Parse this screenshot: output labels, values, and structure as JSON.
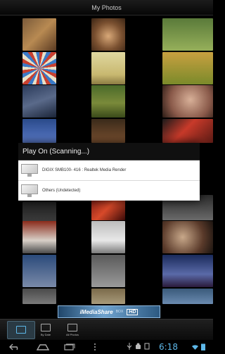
{
  "app": {
    "title": "My Photos"
  },
  "dialog": {
    "title": "Play On (Scanning...)",
    "devices": [
      {
        "label": "DIGIX SMB100- 416 : Realtek Media Render"
      },
      {
        "label": "Others (Undetected)"
      }
    ]
  },
  "banner": {
    "prefix": "iMediaShare",
    "brand": "iMediaShare",
    "suffix": "BOX",
    "badge": "HD"
  },
  "tabs": [
    {
      "label": "",
      "icon": "photos-grid-icon",
      "active": true
    },
    {
      "label": "By Date",
      "icon": "calendar-icon",
      "active": false
    },
    {
      "label": "All Photos",
      "icon": "all-photos-icon",
      "active": false
    }
  ],
  "system": {
    "time": "6:18",
    "accent_color": "#5db7e8"
  },
  "colors": {
    "background": "#000000",
    "dialog_header": "#101010",
    "dialog_body": "#ffffff"
  }
}
